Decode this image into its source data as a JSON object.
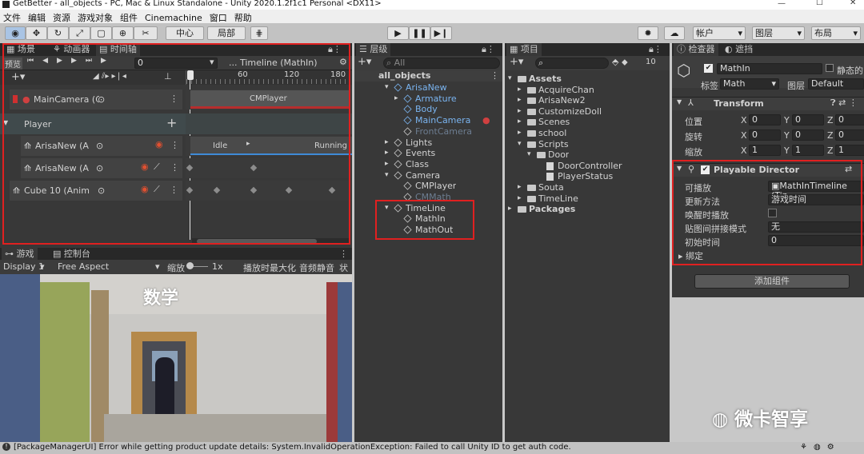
{
  "window": {
    "title": "GetBetter - all_objects - PC, Mac & Linux Standalone - Unity 2020.1.2f1c1 Personal <DX11>"
  },
  "menu": [
    "文件",
    "编辑",
    "资源",
    "游戏对象",
    "组件",
    "Cinemachine",
    "窗口",
    "帮助"
  ],
  "toolbar": {
    "pivot": "中心",
    "space": "局部",
    "account": "帐户",
    "layers": "图层",
    "layout": "布局"
  },
  "scene_tabs": {
    "scene": "场景",
    "animator": "动画器",
    "timeline": "时间轴"
  },
  "timeline": {
    "preview": "预览",
    "frame": "0",
    "asset": "... Timeline (MathIn)",
    "ruler": [
      "0",
      "60",
      "120",
      "180"
    ],
    "camera_track": "MainCamera (C",
    "camera_clip": "CMPlayer",
    "group": "Player",
    "tracks": [
      "ArisaNew (A",
      "ArisaNew (A",
      "Cube 10 (Anim"
    ],
    "clip_idle": "Idle",
    "clip_running": "Running"
  },
  "game_tabs": {
    "game": "游戏",
    "console": "控制台"
  },
  "game_bar": {
    "display": "Display 1",
    "aspect": "Free Aspect",
    "scale_label": "缩放",
    "scale_value": "1x",
    "maximize": "播放时最大化",
    "mute": "音频静音",
    "stats": "状态"
  },
  "game_view": {
    "sign": "数学"
  },
  "hierarchy": {
    "tab": "层级",
    "search": "All",
    "scene": "all_objects",
    "items": [
      {
        "name": "ArisaNew",
        "style": "blue"
      },
      {
        "name": "Armature",
        "style": "blue"
      },
      {
        "name": "Body",
        "style": "blue"
      },
      {
        "name": "MainCamera",
        "style": "blue"
      },
      {
        "name": "FrontCamera",
        "style": "grey"
      },
      {
        "name": "Lights",
        "style": "normal"
      },
      {
        "name": "Events",
        "style": "normal"
      },
      {
        "name": "Class",
        "style": "normal"
      },
      {
        "name": "Camera",
        "style": "normal"
      },
      {
        "name": "CMPlayer",
        "style": "normal"
      },
      {
        "name": "CMMath",
        "style": "grey"
      },
      {
        "name": "TimeLine",
        "style": "normal"
      },
      {
        "name": "MathIn",
        "style": "normal"
      },
      {
        "name": "MathOut",
        "style": "normal"
      }
    ]
  },
  "project": {
    "tab": "项目",
    "hidden_count": "10",
    "items": [
      "Assets",
      "AcquireChan",
      "ArisaNew2",
      "CustomizeDoll",
      "Scenes",
      "school",
      "Scripts",
      "Door",
      "DoorController",
      "PlayerStatus",
      "Souta",
      "TimeLine",
      "Packages"
    ]
  },
  "inspector": {
    "tab": "检查器",
    "tab2": "遮挡",
    "object_name": "MathIn",
    "static_label": "静态的",
    "tag_label": "标签",
    "tag": "Math",
    "layer_label": "图层",
    "layer": "Default",
    "transform": {
      "title": "Transform",
      "rows": [
        {
          "label": "位置",
          "x": "0",
          "y": "0",
          "z": "0"
        },
        {
          "label": "旋转",
          "x": "0",
          "y": "0",
          "z": "0"
        },
        {
          "label": "缩放",
          "x": "1",
          "y": "1",
          "z": "1"
        }
      ]
    },
    "director": {
      "title": "Playable Director",
      "playable_label": "可播放",
      "playable": "MathInTimeline (Tin",
      "update_label": "更新方法",
      "update": "游戏时间",
      "awake_label": "唤醒时播放",
      "wrap_label": "贴图间拼接模式",
      "wrap": "无",
      "initial_label": "初始时间",
      "initial": "0",
      "bindings": "绑定"
    },
    "add_component": "添加组件"
  },
  "watermark": "微卡智享",
  "status": {
    "message": "[PackageManagerUI] Error while getting product update details: System.InvalidOperationException: Failed to call Unity ID to get auth code."
  },
  "colors": {
    "highlight_red": "#e02020",
    "blue_text": "#7ab4f0",
    "track_blue": "#3f8ad6"
  }
}
